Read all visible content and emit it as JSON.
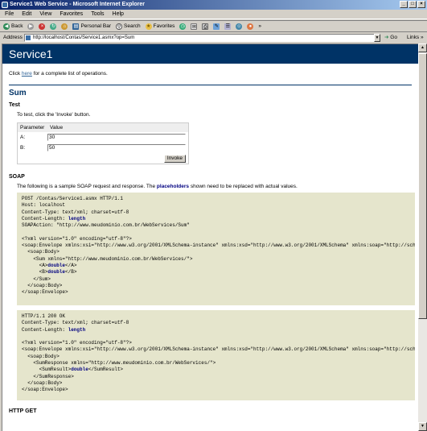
{
  "window": {
    "title": "Service1 Web Service - Microsoft Internet Explorer"
  },
  "menu": [
    "File",
    "Edit",
    "View",
    "Favorites",
    "Tools",
    "Help"
  ],
  "toolbar": {
    "back": "Back",
    "search": "Search",
    "favorites": "Favorites",
    "personal_bar": "Personal Bar"
  },
  "address": {
    "label": "Address",
    "url": "http://localhost/Contas/Service1.asmx?op=Sum",
    "go": "Go",
    "links": "Links"
  },
  "page": {
    "banner": "Service1",
    "intro_pre": "Click ",
    "intro_link": "here",
    "intro_post": " for a complete list of operations.",
    "operation": "Sum",
    "test_heading": "Test",
    "test_instruction": "To test, click the 'Invoke' button.",
    "param_header": "Parameter",
    "value_header": "Value",
    "params": [
      {
        "name": "A:",
        "value": "30"
      },
      {
        "name": "B:",
        "value": "50"
      }
    ],
    "invoke_label": "Invoke",
    "soap_heading": "SOAP",
    "soap_text_pre": "The following is a sample SOAP request and response. The ",
    "soap_text_ph": "placeholders",
    "soap_text_post": " shown need to be replaced with actual values.",
    "request_pre": "POST /Contas/Service1.asmx HTTP/1.1\nHost: localhost\nContent-Type: text/xml; charset=utf-8\nContent-Length: ",
    "request_len": "length",
    "request_post": "\nSOAPAction: \"http://www.meudominio.com.br/WebServices/Sum\"\n\n<?xml version=\"1.0\" encoding=\"utf-8\"?>\n<soap:Envelope xmlns:xsi=\"http://www.w3.org/2001/XMLSchema-instance\" xmlns:xsd=\"http://www.w3.org/2001/XMLSchema\" xmlns:soap=\"http://schemas.xmlsoap.org/soap/envelope/\">\n  <soap:Body>\n    <Sum xmlns=\"http://www.meudominio.com.br/WebServices/\">\n      <A>",
    "request_a": "double",
    "request_mid": "</A>\n      <B>",
    "request_b": "double",
    "request_end": "</B>\n    </Sum>\n  </soap:Body>\n</soap:Envelope>",
    "response_pre": "HTTP/1.1 200 OK\nContent-Type: text/xml; charset=utf-8\nContent-Length: ",
    "response_len": "length",
    "response_post": "\n\n<?xml version=\"1.0\" encoding=\"utf-8\"?>\n<soap:Envelope xmlns:xsi=\"http://www.w3.org/2001/XMLSchema-instance\" xmlns:xsd=\"http://www.w3.org/2001/XMLSchema\" xmlns:soap=\"http://schemas.xmlsoap.org/soap/envelope/\">\n  <soap:Body>\n    <SumResponse xmlns=\"http://www.meudominio.com.br/WebServices/\">\n      <SumResult>",
    "response_val": "double",
    "response_end": "</SumResult>\n    </SumResponse>\n  </soap:Body>\n</soap:Envelope>",
    "httpget_heading": "HTTP GET"
  },
  "colors": {
    "banner": "#003366",
    "code_bg": "#e5e5cc",
    "link": "#336699"
  }
}
